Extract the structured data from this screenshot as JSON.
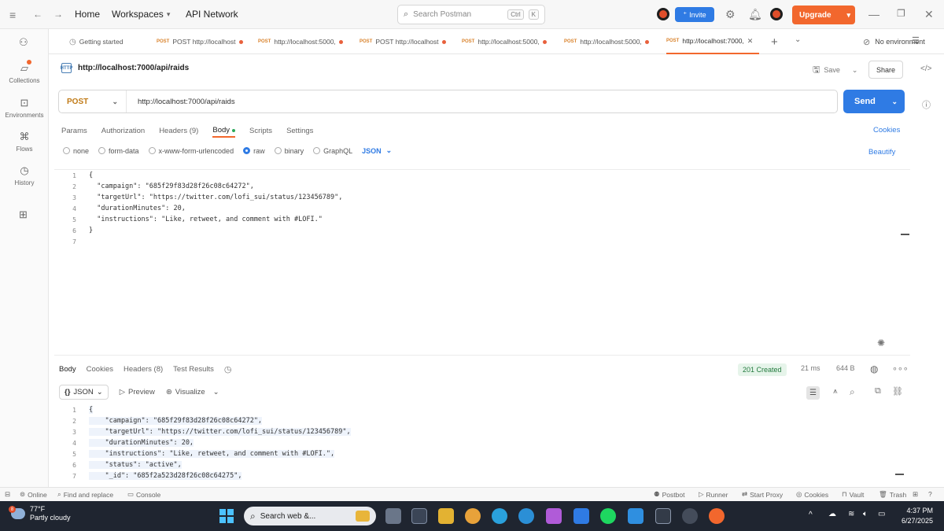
{
  "topbar": {
    "home": "Home",
    "workspaces": "Workspaces",
    "api_network": "API Network",
    "search_placeholder": "Search Postman",
    "search_shortcut_ctrl": "Ctrl",
    "search_shortcut_key": "K",
    "invite_label": "Invite",
    "upgrade_label": "Upgrade"
  },
  "sidebar": {
    "items": [
      {
        "label": "Collections",
        "icon": "collections-icon"
      },
      {
        "label": "Environments",
        "icon": "environments-icon"
      },
      {
        "label": "Flows",
        "icon": "flows-icon"
      },
      {
        "label": "History",
        "icon": "history-icon"
      }
    ]
  },
  "tabs": [
    {
      "method": "",
      "label": "Getting started"
    },
    {
      "method": "POST",
      "label": "POST http://localhost"
    },
    {
      "method": "POST",
      "label": "http://localhost:5000,"
    },
    {
      "method": "POST",
      "label": "POST http://localhost"
    },
    {
      "method": "POST",
      "label": "http://localhost:5000,"
    },
    {
      "method": "POST",
      "label": "http://localhost:5000,"
    },
    {
      "method": "POST",
      "label": "http://localhost:7000,"
    }
  ],
  "environment": {
    "label": "No environment"
  },
  "request": {
    "title": "http://localhost:7000/api/raids",
    "badge": "HTTP",
    "save_label": "Save",
    "share_label": "Share",
    "method": "POST",
    "url": "http://localhost:7000/api/raids",
    "send_label": "Send",
    "subtabs": [
      "Params",
      "Authorization",
      "Headers (9)",
      "Body",
      "Scripts",
      "Settings"
    ],
    "cookies_label": "Cookies",
    "body_options": [
      "none",
      "form-data",
      "x-www-form-urlencoded",
      "raw",
      "binary",
      "GraphQL"
    ],
    "body_format": "JSON",
    "beautify_label": "Beautify",
    "body_lines": [
      {
        "n": "1",
        "t": "{"
      },
      {
        "n": "2",
        "t": "  \"campaign\": \"685f29f83d28f26c08c64272\","
      },
      {
        "n": "3",
        "t": "  \"targetUrl\": \"https://twitter.com/lofi_sui/status/123456789\","
      },
      {
        "n": "4",
        "t": "  \"durationMinutes\": 20,"
      },
      {
        "n": "5",
        "t": "  \"instructions\": \"Like, retweet, and comment with #LOFI.\""
      },
      {
        "n": "6",
        "t": "}"
      },
      {
        "n": "7",
        "t": ""
      }
    ]
  },
  "response": {
    "tabs": [
      "Body",
      "Cookies",
      "Headers (8)",
      "Test Results"
    ],
    "status": "201 Created",
    "time": "21 ms",
    "size": "644 B",
    "format": "JSON",
    "preview_label": "Preview",
    "visualize_label": "Visualize",
    "body_lines": [
      {
        "n": "1",
        "t": "{"
      },
      {
        "n": "2",
        "t": "    \"campaign\": \"685f29f83d28f26c08c64272\","
      },
      {
        "n": "3",
        "t": "    \"targetUrl\": \"https://twitter.com/lofi_sui/status/123456789\","
      },
      {
        "n": "4",
        "t": "    \"durationMinutes\": 20,"
      },
      {
        "n": "5",
        "t": "    \"instructions\": \"Like, retweet, and comment with #LOFI.\","
      },
      {
        "n": "6",
        "t": "    \"status\": \"active\","
      },
      {
        "n": "7",
        "t": "    \"_id\": \"685f2a523d28f26c08c64275\","
      }
    ]
  },
  "statusbar": {
    "online": "Online",
    "find_replace": "Find and replace",
    "console": "Console",
    "postbot": "Postbot",
    "runner": "Runner",
    "start_proxy": "Start Proxy",
    "cookies": "Cookies",
    "vault": "Vault",
    "trash": "Trash"
  },
  "taskbar": {
    "weather_temp": "77°F",
    "weather_desc": "Partly cloudy",
    "weather_badge": "8",
    "search_placeholder": "Search web &...",
    "time": "4:37 PM",
    "date": "6/27/2025"
  },
  "colors": {
    "accent": "#f2672d",
    "primary": "#2f7be4",
    "success": "#237a3e"
  }
}
